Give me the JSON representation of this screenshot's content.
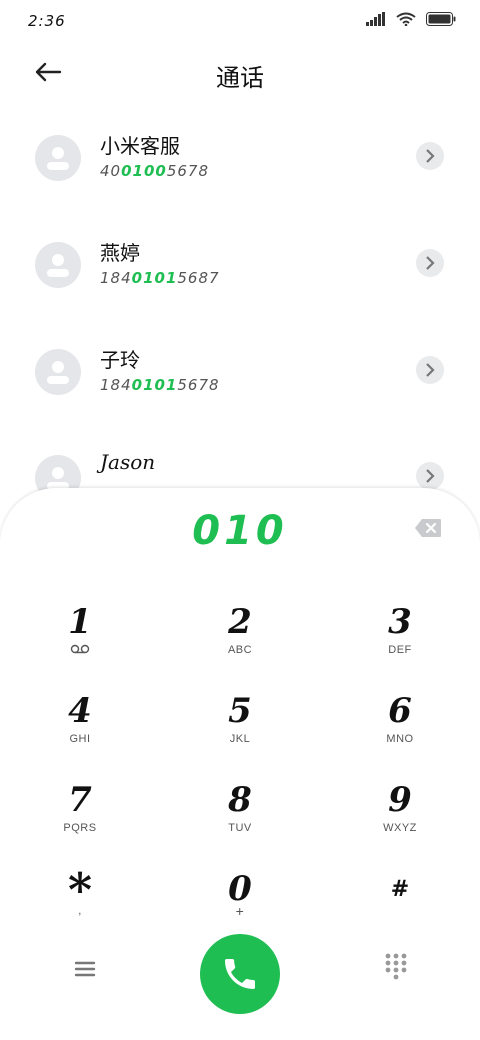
{
  "status": {
    "time": "2:36"
  },
  "header": {
    "title": "通话"
  },
  "contacts": [
    {
      "name": "小米客服",
      "number_pre": "40",
      "number_hl": "0100",
      "number_post": "5678"
    },
    {
      "name": "燕婷",
      "number_pre": "184",
      "number_hl": "0101",
      "number_post": "5687"
    },
    {
      "name": "子玲",
      "number_pre": "184",
      "number_hl": "0101",
      "number_post": "5678"
    },
    {
      "name": "Jason",
      "number_pre": "",
      "number_hl": "",
      "number_post": ""
    }
  ],
  "dialpad": {
    "input": "010",
    "keys": [
      {
        "digit": "1",
        "letters": ""
      },
      {
        "digit": "2",
        "letters": "ABC"
      },
      {
        "digit": "3",
        "letters": "DEF"
      },
      {
        "digit": "4",
        "letters": "GHI"
      },
      {
        "digit": "5",
        "letters": "JKL"
      },
      {
        "digit": "6",
        "letters": "MNO"
      },
      {
        "digit": "7",
        "letters": "PQRS"
      },
      {
        "digit": "8",
        "letters": "TUV"
      },
      {
        "digit": "9",
        "letters": "WXYZ"
      },
      {
        "digit": "*",
        "letters": ","
      },
      {
        "digit": "0",
        "letters": "+"
      },
      {
        "digit": "#",
        "letters": ""
      }
    ]
  },
  "colors": {
    "accent": "#1fbe52",
    "avatar_bg": "#e4e6ea"
  }
}
